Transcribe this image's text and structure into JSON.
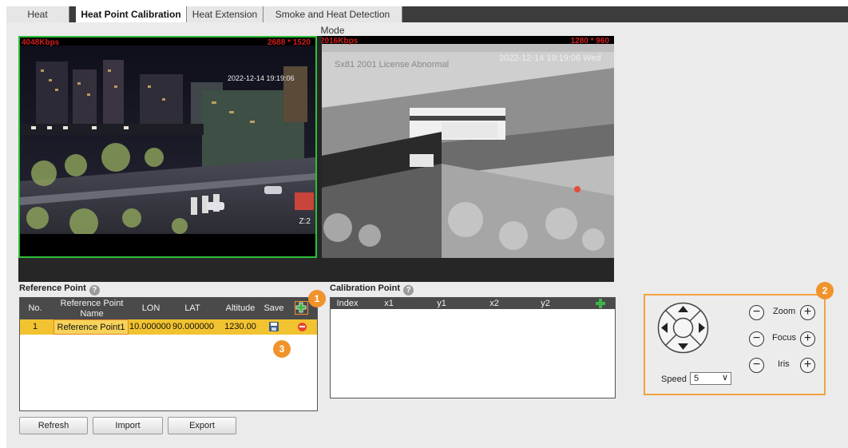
{
  "tabs": [
    "Heat",
    "Heat Point Calibration",
    "Heat Extension",
    "Smoke and Heat Detection Mode"
  ],
  "left_video": {
    "bitrate": "4048Kbps",
    "resolution": "2688 * 1520",
    "timestamp": "2022-12-14 19:19:06",
    "zoom": "Z:2"
  },
  "right_video": {
    "bitrate": "2016Kbps",
    "resolution": "1280 * 960",
    "timestamp": "2022-12-14 19:19:06 Wed",
    "ghost_text": "Sx81 2001  License Abnormal"
  },
  "reference_point": {
    "title": "Reference Point",
    "help": "?",
    "columns": [
      "No.",
      "Reference Point Name",
      "LON",
      "LAT",
      "Altitude",
      "Save"
    ],
    "rows": [
      {
        "no": "1",
        "name": "Reference Point1",
        "lon": "10.000000",
        "lat": "90.000000",
        "altitude": "1230.00"
      }
    ]
  },
  "calibration_point": {
    "title": "Calibration Point",
    "help": "?",
    "columns": [
      "Index",
      "x1",
      "y1",
      "x2",
      "y2"
    ]
  },
  "buttons": {
    "refresh": "Refresh",
    "import": "Import",
    "export": "Export"
  },
  "ptz": {
    "zoom": "Zoom",
    "focus": "Focus",
    "iris": "Iris",
    "speed_label": "Speed",
    "speed_value": "5"
  },
  "badges": [
    "1",
    "2",
    "3"
  ],
  "colors": {
    "accent": "#f0932b",
    "highlight_row": "#f2c330",
    "selected_border": "#2fbf3a",
    "add_icon": "#3fb54a",
    "delete_icon": "#e5452f"
  }
}
